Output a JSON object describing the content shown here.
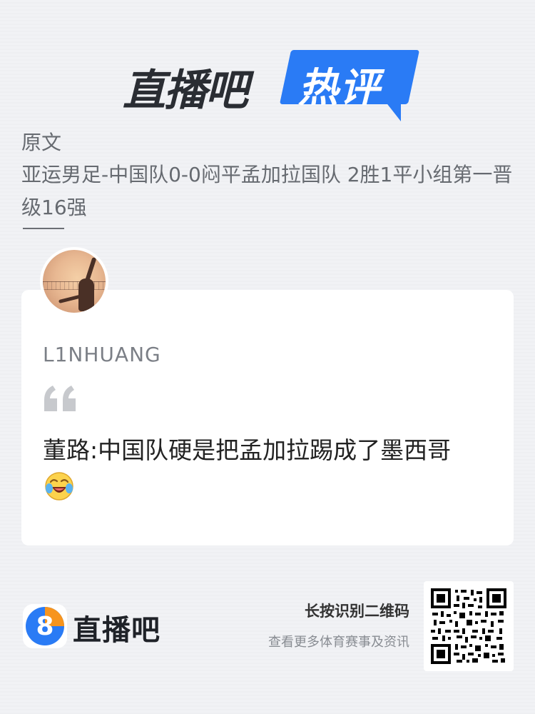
{
  "header": {
    "brand": "直播吧",
    "section": "热评"
  },
  "original": {
    "label": "原文",
    "title": "亚运男足-中国队0-0闷平孟加拉国队 2胜1平小组第一晋级16强"
  },
  "comment": {
    "username": "L1NHUANG",
    "text": "董路:中国队硬是把孟加拉踢成了墨西哥",
    "emoji": "crying-laughing-emoji"
  },
  "footer": {
    "logo_digit": "8",
    "brand": "直播吧",
    "qr_hint": "长按识别二维码",
    "qr_sub": "查看更多体育赛事及资讯"
  },
  "colors": {
    "accent": "#2a7bf5",
    "background": "#f1f2f5",
    "card": "#ffffff",
    "logo_orange": "#f7941d",
    "logo_blue": "#2a7bf5"
  }
}
